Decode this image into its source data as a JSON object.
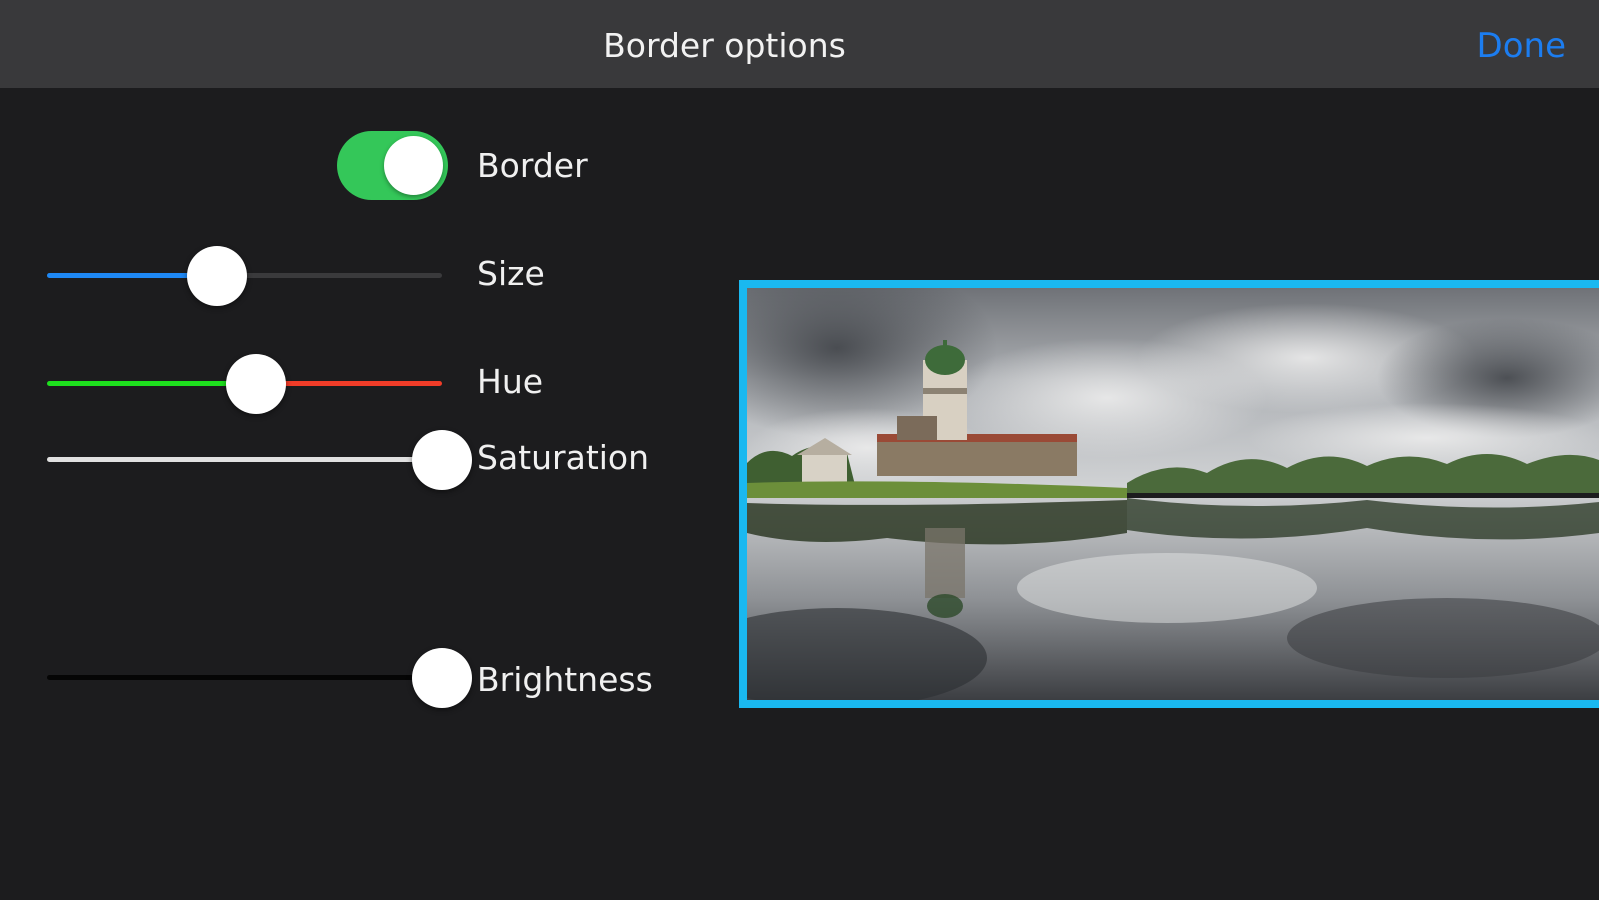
{
  "navbar": {
    "title": "Border options",
    "done_label": "Done"
  },
  "border_toggle": {
    "label": "Border",
    "on": true
  },
  "sliders": {
    "size": {
      "label": "Size",
      "value": 0.43
    },
    "hue": {
      "label": "Hue",
      "value": 0.53
    },
    "saturation": {
      "label": "Saturation",
      "value": 1.0
    },
    "brightness": {
      "label": "Brightness",
      "value": 1.0
    }
  },
  "colors": {
    "background": "#1c1c1e",
    "navbar": "#39393b",
    "accent": "#1c7df0",
    "toggle_on": "#34c759",
    "size_fill": "#1e88f5",
    "size_track": "#3a3a3c",
    "hue_left": "#1ee01e",
    "hue_right": "#f03c28",
    "saturation_fill": "#e0e0e0",
    "brightness_fill": "#050505",
    "border_color": "#1ab8f0"
  },
  "preview": {
    "icon": "castle-lake-photo"
  }
}
